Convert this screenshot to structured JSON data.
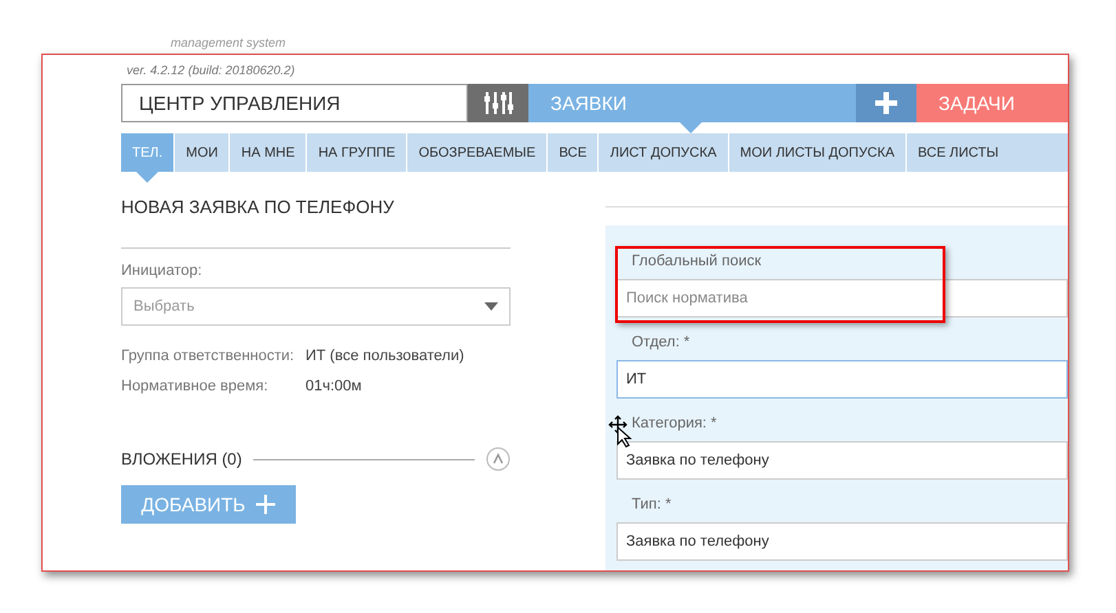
{
  "header": {
    "subtitle": "management system",
    "version": "ver. 4.2.12 (build: 20180620.2)"
  },
  "nav": {
    "title": "ЦЕНТР УПРАВЛЕНИЯ",
    "sections": [
      {
        "kind": "requests",
        "label": "ЗАЯВКИ"
      },
      {
        "kind": "tasks",
        "label": "ЗАДАЧИ"
      }
    ]
  },
  "tabs": [
    {
      "label": "ТЕЛ.",
      "selected": true
    },
    {
      "label": "МОИ",
      "selected": false
    },
    {
      "label": "НА МНЕ",
      "selected": false
    },
    {
      "label": "НА ГРУППЕ",
      "selected": false
    },
    {
      "label": "ОБОЗРЕВАЕМЫЕ",
      "selected": false
    },
    {
      "label": "ВСЕ",
      "selected": false
    },
    {
      "label": "ЛИСТ ДОПУСКА",
      "selected": false
    },
    {
      "label": "МОИ ЛИСТЫ ДОПУСКА",
      "selected": false
    },
    {
      "label": "ВСЕ ЛИСТЫ",
      "selected": false
    }
  ],
  "form": {
    "heading": "НОВАЯ ЗАЯВКА ПО ТЕЛЕФОНУ",
    "initiator": {
      "label": "Инициатор:",
      "placeholder": "Выбрать"
    },
    "info": [
      {
        "label": "Группа ответственности:",
        "value": "ИТ (все пользователи)"
      },
      {
        "label": "Нормативное время:",
        "value": "01ч:00м"
      }
    ],
    "attachments": {
      "title": "ВЛОЖЕНИЯ (0)",
      "add_button": "ДОБАВИТЬ"
    }
  },
  "panel": {
    "search": {
      "label": "Глобальный поиск",
      "placeholder": "Поиск норматива"
    },
    "fields": [
      {
        "label": "Отдел: *",
        "value": "ИТ",
        "focused": true
      },
      {
        "label": "Категория: *",
        "value": "Заявка по телефону",
        "focused": false
      },
      {
        "label": "Тип: *",
        "value": "Заявка по телефону",
        "focused": false
      }
    ]
  }
}
